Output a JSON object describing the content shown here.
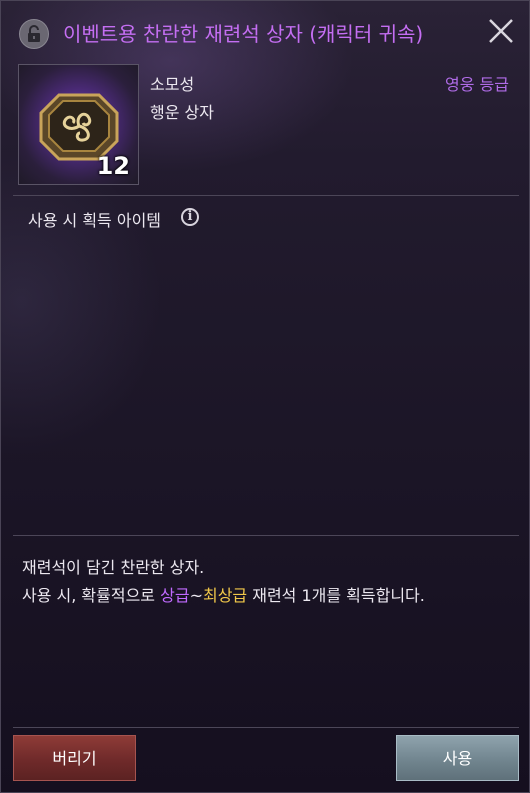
{
  "header": {
    "title": "이벤트용 찬란한 재련석 상자 (캐릭터 귀속)"
  },
  "item": {
    "quantity": "12",
    "type": "소모성",
    "subtype": "행운 상자",
    "grade": "영웅 등급"
  },
  "section": {
    "obtain_label": "사용 시 획득 아이템",
    "info_icon_glyph": "i"
  },
  "description": {
    "line1": "재련석이 담긴 찬란한 상자.",
    "line2_prefix": "사용 시, 확률적으로 ",
    "line2_grade_low": "상급",
    "line2_tilde": "~",
    "line2_grade_high": "최상급",
    "line2_suffix": " 재련석 1개를 획득합니다."
  },
  "buttons": {
    "discard_label": "버리기",
    "use_label": "사용"
  },
  "colors": {
    "title": "#c46ef2",
    "grade": "#b06ce8",
    "highlight_purple": "#c06aff",
    "highlight_yellow": "#f1c84a"
  }
}
